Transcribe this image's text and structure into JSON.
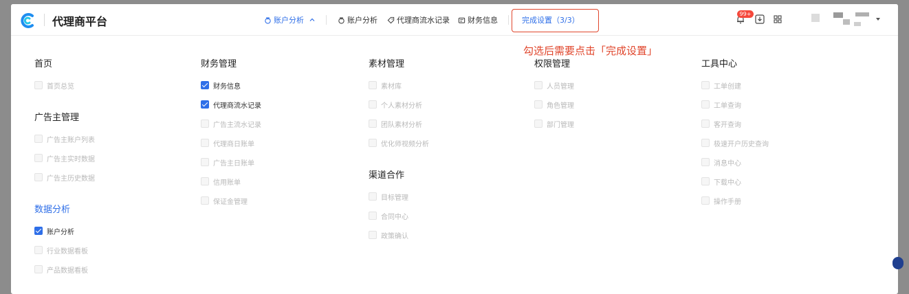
{
  "header": {
    "brand": "代理商平台",
    "nav": [
      {
        "label": "账户分析",
        "active": true,
        "icon": "coin-bag-icon"
      },
      {
        "label": "账户分析",
        "active": false,
        "icon": "coin-bag-icon"
      },
      {
        "label": "代理商流水记录",
        "active": false,
        "icon": "tag-icon"
      },
      {
        "label": "财务信息",
        "active": false,
        "icon": "wallet-icon"
      }
    ],
    "done_button": {
      "label": "完成设置（3/3）",
      "icon": "gear-icon"
    },
    "notification_badge": "99+",
    "colors": {
      "accent": "#2f6fe8",
      "highlight": "#e0452b"
    }
  },
  "hint": "勾选后需要点击「完成设置」",
  "columns": [
    {
      "groups": [
        {
          "title": "首页",
          "highlight": false,
          "items": [
            {
              "label": "首页总览",
              "checked": false
            }
          ]
        },
        {
          "title": "广告主管理",
          "highlight": false,
          "items": [
            {
              "label": "广告主账户列表",
              "checked": false
            },
            {
              "label": "广告主实时数据",
              "checked": false
            },
            {
              "label": "广告主历史数据",
              "checked": false
            }
          ]
        },
        {
          "title": "数据分析",
          "highlight": true,
          "items": [
            {
              "label": "账户分析",
              "checked": true
            },
            {
              "label": "行业数据看板",
              "checked": false
            },
            {
              "label": "产品数据看板",
              "checked": false
            }
          ]
        }
      ]
    },
    {
      "groups": [
        {
          "title": "财务管理",
          "highlight": false,
          "items": [
            {
              "label": "财务信息",
              "checked": true
            },
            {
              "label": "代理商流水记录",
              "checked": true
            },
            {
              "label": "广告主流水记录",
              "checked": false
            },
            {
              "label": "代理商日账单",
              "checked": false
            },
            {
              "label": "广告主日账单",
              "checked": false
            },
            {
              "label": "信用账单",
              "checked": false
            },
            {
              "label": "保证金管理",
              "checked": false
            }
          ]
        }
      ]
    },
    {
      "groups": [
        {
          "title": "素材管理",
          "highlight": false,
          "items": [
            {
              "label": "素材库",
              "checked": false
            },
            {
              "label": "个人素材分析",
              "checked": false
            },
            {
              "label": "团队素材分析",
              "checked": false
            },
            {
              "label": "优化师视频分析",
              "checked": false
            }
          ]
        },
        {
          "title": "渠道合作",
          "highlight": false,
          "items": [
            {
              "label": "目标管理",
              "checked": false
            },
            {
              "label": "合同中心",
              "checked": false
            },
            {
              "label": "政策确认",
              "checked": false
            }
          ]
        }
      ]
    },
    {
      "groups": [
        {
          "title": "权限管理",
          "highlight": false,
          "items": [
            {
              "label": "人员管理",
              "checked": false
            },
            {
              "label": "角色管理",
              "checked": false
            },
            {
              "label": "部门管理",
              "checked": false
            }
          ]
        }
      ]
    },
    {
      "groups": [
        {
          "title": "工具中心",
          "highlight": false,
          "items": [
            {
              "label": "工单创建",
              "checked": false
            },
            {
              "label": "工单查询",
              "checked": false
            },
            {
              "label": "客开查询",
              "checked": false
            },
            {
              "label": "极速开户历史查询",
              "checked": false
            },
            {
              "label": "消息中心",
              "checked": false
            },
            {
              "label": "下载中心",
              "checked": false
            },
            {
              "label": "操作手册",
              "checked": false
            }
          ]
        }
      ]
    }
  ]
}
